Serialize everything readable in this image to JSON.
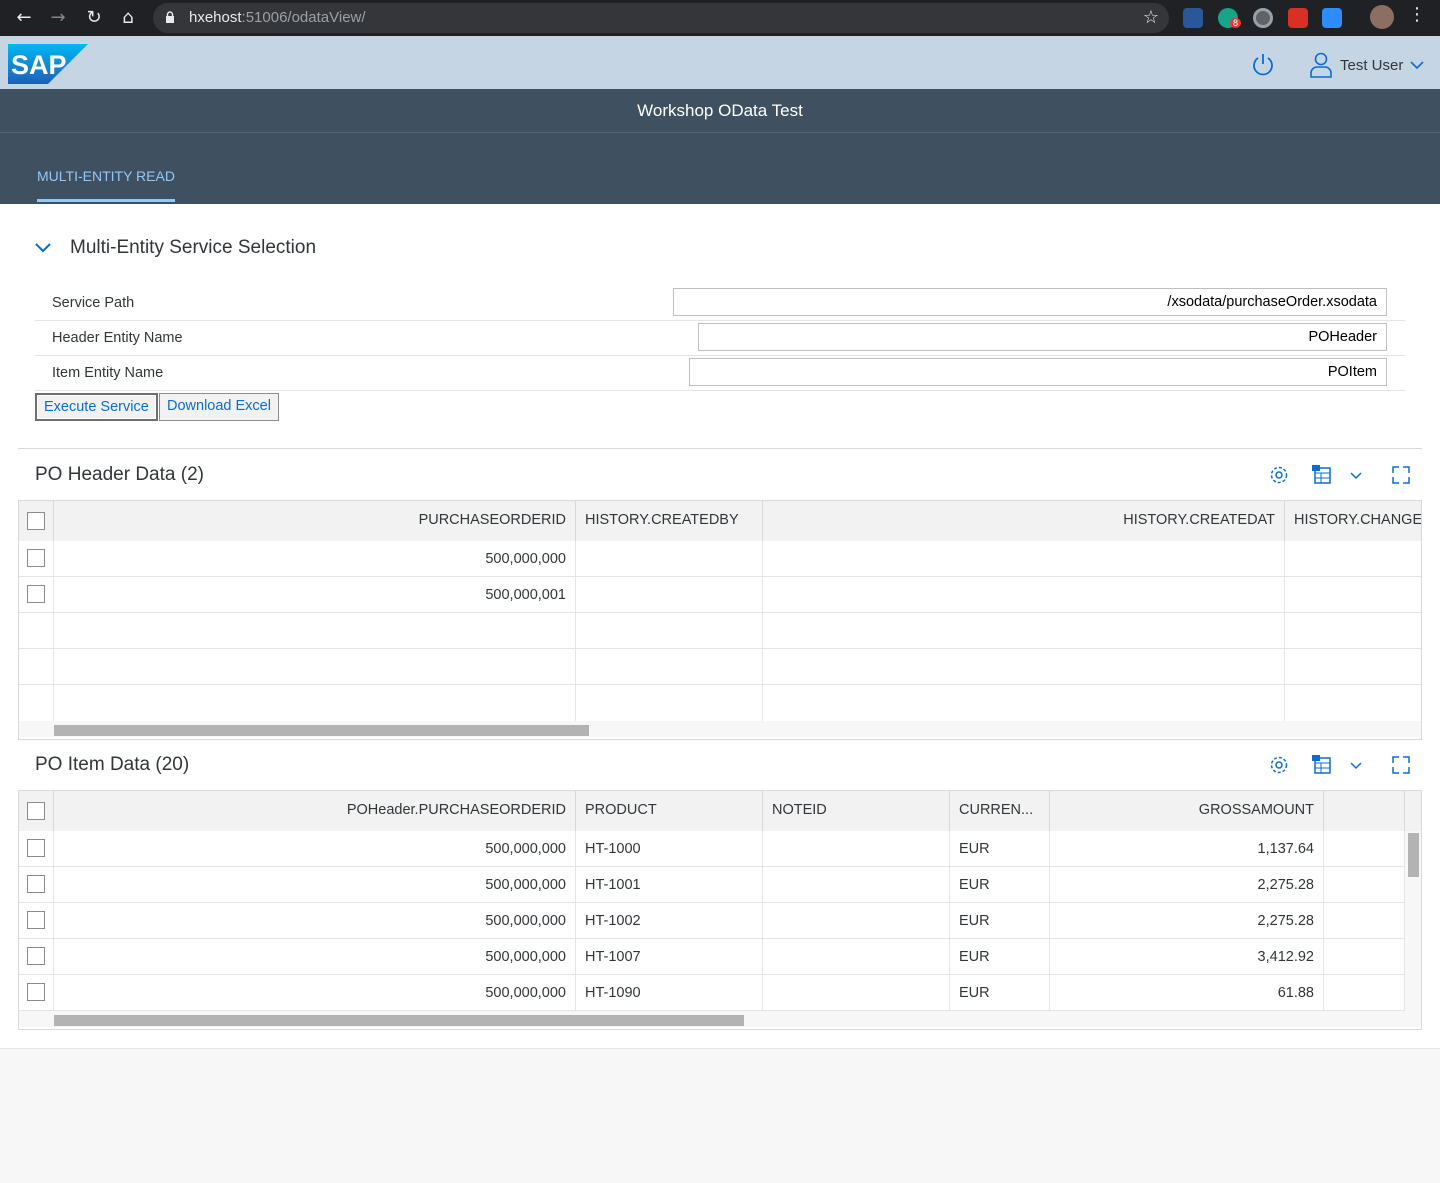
{
  "browser": {
    "url_host": "hxehost",
    "url_rest": ":51006/odataView/",
    "ext_badge": "8"
  },
  "shell": {
    "logo_text": "SAP",
    "user_name": "Test User"
  },
  "app": {
    "title": "Workshop OData Test",
    "tab_label": "MULTI-ENTITY READ"
  },
  "selection": {
    "title": "Multi-Entity Service Selection",
    "service_path_label": "Service Path",
    "service_path_value": "/xsodata/purchaseOrder.xsodata",
    "header_entity_label": "Header Entity Name",
    "header_entity_value": "POHeader",
    "item_entity_label": "Item Entity Name",
    "item_entity_value": "POItem",
    "execute_label": "Execute Service",
    "download_label": "Download Excel"
  },
  "header_table": {
    "title": "PO Header Data (2)",
    "columns": [
      "PURCHASEORDERID",
      "HISTORY.CREATEDBY",
      "HISTORY.CREATEDAT",
      "HISTORY.CHANGE"
    ],
    "rows": [
      [
        "500,000,000",
        "",
        "",
        ""
      ],
      [
        "500,000,001",
        "",
        "",
        ""
      ]
    ]
  },
  "item_table": {
    "title": "PO Item Data (20)",
    "columns": [
      "POHeader.PURCHASEORDERID",
      "PRODUCT",
      "NOTEID",
      "CURREN...",
      "GROSSAMOUNT",
      ""
    ],
    "rows": [
      [
        "500,000,000",
        "HT-1000",
        "",
        "EUR",
        "1,137.64",
        ""
      ],
      [
        "500,000,000",
        "HT-1001",
        "",
        "EUR",
        "2,275.28",
        ""
      ],
      [
        "500,000,000",
        "HT-1002",
        "",
        "EUR",
        "2,275.28",
        ""
      ],
      [
        "500,000,000",
        "HT-1007",
        "",
        "EUR",
        "3,412.92",
        ""
      ],
      [
        "500,000,000",
        "HT-1090",
        "",
        "EUR",
        "61.88",
        ""
      ]
    ]
  }
}
